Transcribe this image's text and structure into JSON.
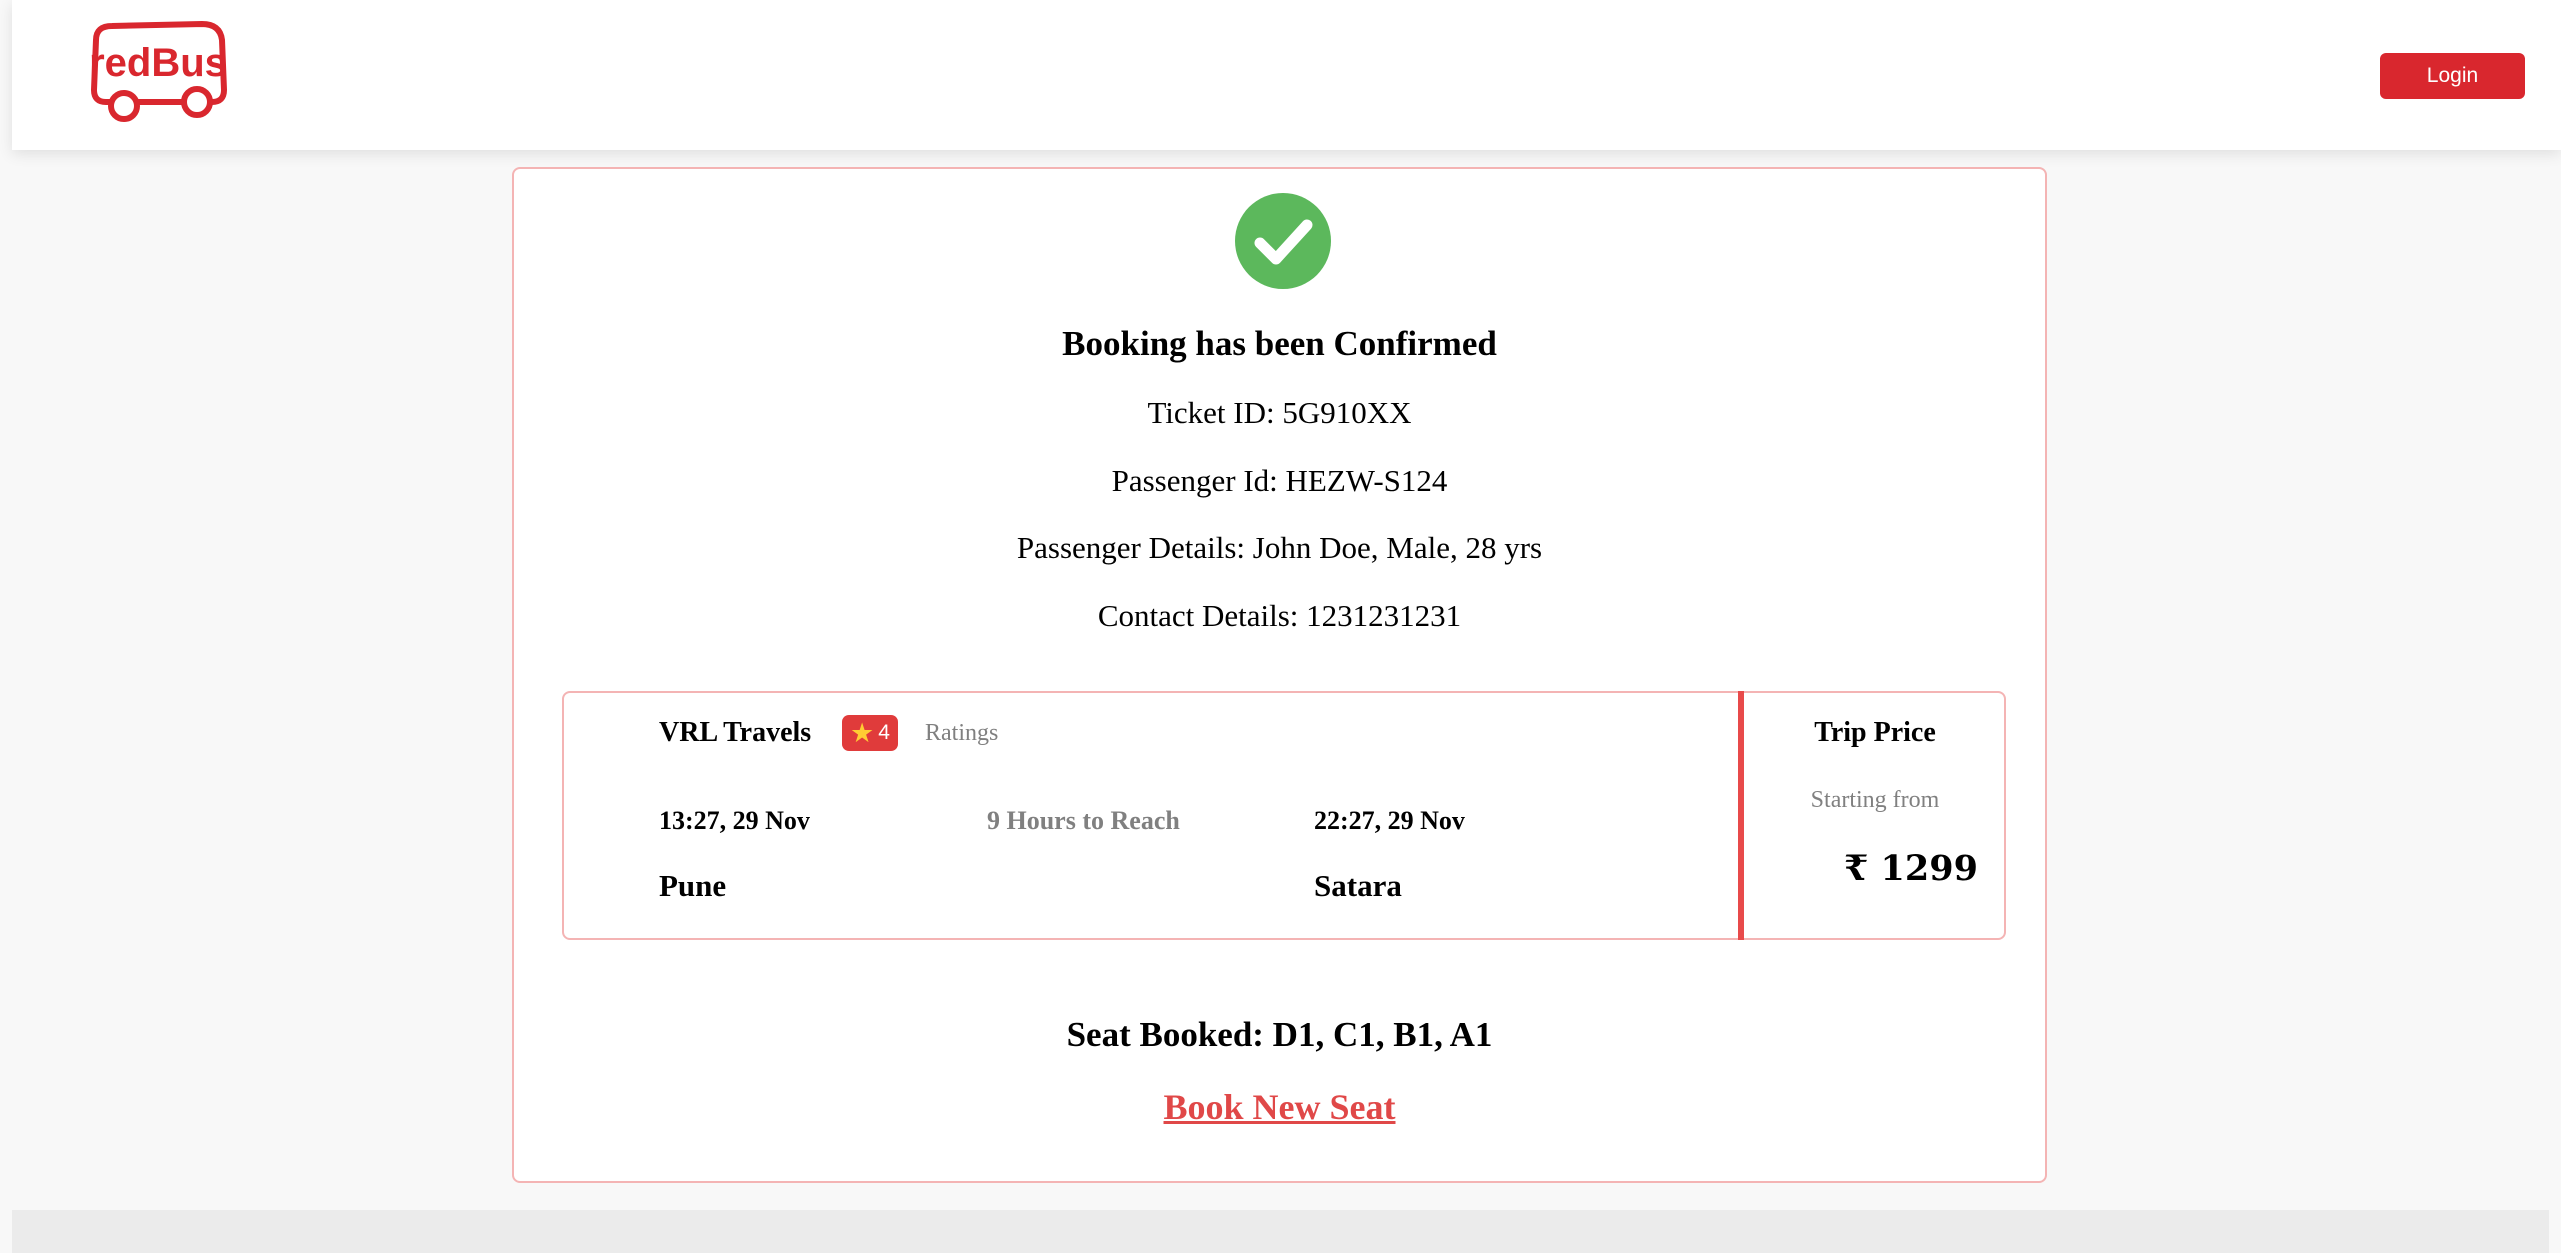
{
  "header": {
    "logo_text": "redBus",
    "login_label": "Login",
    "brand_color": "#d9272e"
  },
  "confirmation": {
    "icon": "check-circle-icon",
    "title": "Booking has been Confirmed",
    "ticket_id": "Ticket ID: 5G910XX",
    "passenger_id": "Passenger Id: HEZW-S124",
    "passenger_details": "Passenger Details: John Doe, Male, 28 yrs",
    "contact_details": "Contact Details: 1231231231"
  },
  "trip": {
    "operator": "VRL Travels",
    "rating_value": "4",
    "rating_icon": "star-icon",
    "ratings_label": "Ratings",
    "departure_time": "13:27, 29 Nov",
    "duration": "9 Hours to Reach",
    "arrival_time": "22:27, 29 Nov",
    "source": "Pune",
    "destination": "Satara",
    "price_title": "Trip Price",
    "starting_from": "Starting from",
    "price": "₹ 1299"
  },
  "booking": {
    "seats": "Seat Booked: D1, C1, B1, A1",
    "book_new_label": "Book New Seat"
  }
}
